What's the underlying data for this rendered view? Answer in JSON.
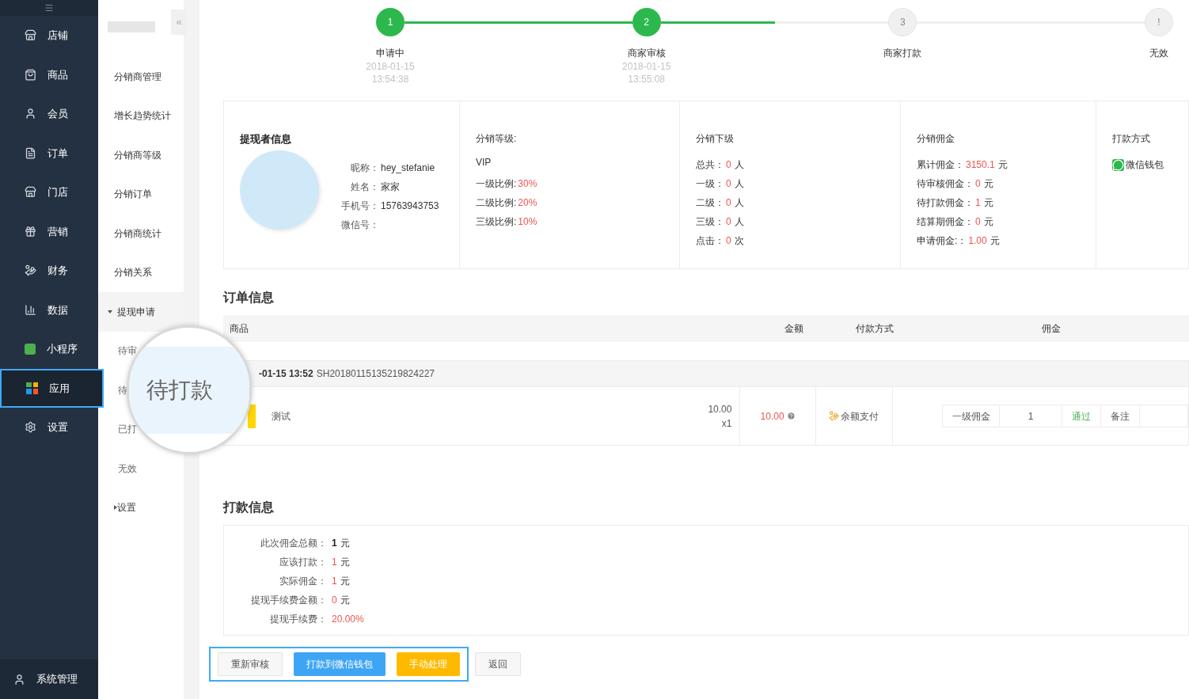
{
  "sidebar": {
    "items": [
      {
        "label": "店铺",
        "selected": false
      },
      {
        "label": "商品",
        "selected": false
      },
      {
        "label": "会员",
        "selected": false
      },
      {
        "label": "订单",
        "selected": false
      },
      {
        "label": "门店",
        "selected": false
      },
      {
        "label": "营销",
        "selected": false
      },
      {
        "label": "财务",
        "selected": false
      },
      {
        "label": "数据",
        "selected": false
      },
      {
        "label": "小程序",
        "selected": false
      },
      {
        "label": "应用",
        "selected": true
      },
      {
        "label": "设置",
        "selected": false
      }
    ],
    "footer": "系统管理"
  },
  "submenu": {
    "collapse": "«",
    "items": [
      {
        "label": "分销商管理"
      },
      {
        "label": "增长趋势统计"
      },
      {
        "label": "分销商等级"
      },
      {
        "label": "分销订单"
      },
      {
        "label": "分销商统计"
      },
      {
        "label": "分销关系"
      },
      {
        "label": "提现申请",
        "expanded": true,
        "children": [
          {
            "label": "待审"
          },
          {
            "label": "待"
          },
          {
            "label": "已打"
          },
          {
            "label": "无效"
          }
        ]
      },
      {
        "label": "设置",
        "expanded": false
      }
    ]
  },
  "magnifier": {
    "text": "待打款"
  },
  "steps": [
    {
      "number": "1",
      "label": "申请中",
      "date": "2018-01-15",
      "time": "13:54:38",
      "done": true
    },
    {
      "number": "2",
      "label": "商家审核",
      "date": "2018-01-15",
      "time": "13:55:08",
      "done": true
    },
    {
      "number": "3",
      "label": "商家打款",
      "done": false
    },
    {
      "number": "!",
      "label": "无效",
      "done": false
    }
  ],
  "connectors": [
    {
      "level": 1
    },
    {
      "level": 0.5
    }
  ],
  "applicant": {
    "title": "提现者信息",
    "fields": [
      {
        "label": "昵称：",
        "value": "hey_stefanie"
      },
      {
        "label": "姓名：",
        "value": "家家"
      },
      {
        "label": "手机号：",
        "value": "15763943753"
      },
      {
        "label": "微信号："
      }
    ]
  },
  "level_panel": {
    "title": "分销等级:",
    "level": "VIP",
    "rows": [
      {
        "label": "一级比例:",
        "value": "30%"
      },
      {
        "label": "二级比例:",
        "value": "20%"
      },
      {
        "label": "三级比例:",
        "value": "10%"
      }
    ]
  },
  "subordinates": {
    "title": "分销下级",
    "rows": [
      {
        "label": "总共：",
        "value": "0",
        "unit": "人"
      },
      {
        "label": "一级：",
        "value": "0",
        "unit": "人"
      },
      {
        "label": "二级：",
        "value": "0",
        "unit": "人"
      },
      {
        "label": "三级：",
        "value": "0",
        "unit": "人"
      },
      {
        "label": "点击：",
        "value": "0",
        "unit": "次"
      }
    ]
  },
  "commission": {
    "title": "分销佣金",
    "rows": [
      {
        "label": "累计佣金：",
        "value": "3150.1",
        "unit": "元"
      },
      {
        "label": "待审核佣金：",
        "value": "0",
        "unit": "元"
      },
      {
        "label": "待打款佣金：",
        "value": "1",
        "unit": "元"
      },
      {
        "label": "结算期佣金：",
        "value": "0",
        "unit": "元"
      },
      {
        "label": "申请佣金:：",
        "value": "1.00",
        "unit": "元"
      }
    ]
  },
  "payout_method": {
    "title": "打款方式",
    "method": "微信钱包"
  },
  "order": {
    "title": "订单信息",
    "columns": [
      "商品",
      "金额",
      "付款方式",
      "佣金"
    ],
    "group": {
      "time": "-01-15 13:52",
      "number": "SH20180115135219824227"
    },
    "item": {
      "name": "测试",
      "price": "10.00",
      "quantity": "x1",
      "amount": "10.00",
      "payment": "余额支付",
      "commission": {
        "level": "一级佣金",
        "value": "1",
        "status": "通过",
        "note": "备注"
      }
    }
  },
  "payout": {
    "title": "打款信息",
    "rows": [
      {
        "label": "此次佣金总额：",
        "value": "1",
        "unit": "元",
        "kind": "strong"
      },
      {
        "label": "应该打款：",
        "value": "1",
        "unit": "元",
        "kind": "red"
      },
      {
        "label": "实际佣金：",
        "value": "1",
        "unit": "元",
        "kind": "red"
      },
      {
        "label": "提现手续费金额：",
        "value": "0",
        "unit": "元",
        "kind": "red"
      },
      {
        "label": "提现手续费：",
        "value": "20.00%",
        "kind": "red"
      }
    ]
  },
  "buttons": [
    {
      "label": "重新审核",
      "kind": "default"
    },
    {
      "label": "打款到微信钱包",
      "kind": "primary"
    },
    {
      "label": "手动处理",
      "kind": "warning"
    },
    {
      "label": "返回",
      "kind": "default"
    }
  ]
}
